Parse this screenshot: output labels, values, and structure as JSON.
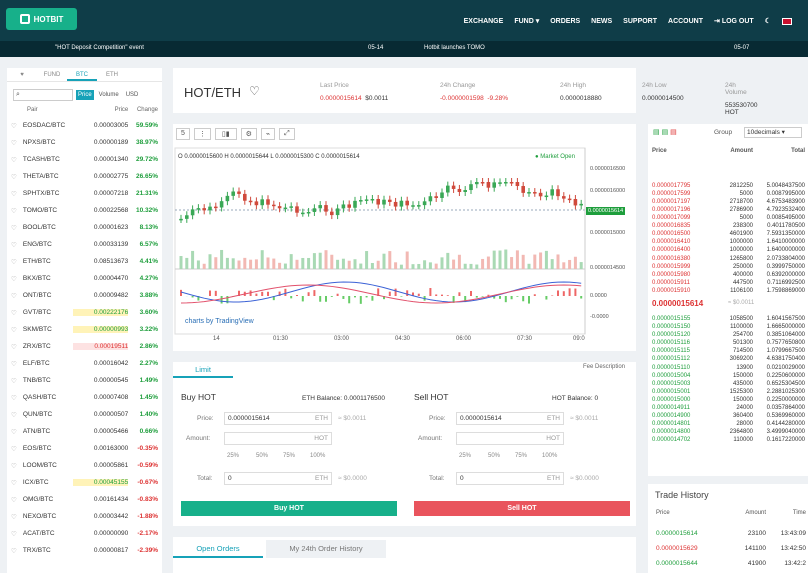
{
  "header": {
    "logo": "HOTBIT",
    "nav": [
      "EXCHANGE",
      "FUND ▾",
      "ORDERS",
      "NEWS",
      "SUPPORT",
      "ACCOUNT",
      "⇥ LOG OUT"
    ]
  },
  "ticker": {
    "left": "\"HOT Deposit Competition\" event",
    "date1": "05-14",
    "middle": "Hotbit launches TOMO",
    "date2": "05-07"
  },
  "market": {
    "tabs": [
      "♥",
      "FUND",
      "BTC",
      "ETH"
    ],
    "sort_buttons": [
      "Price",
      "Volume",
      "USD"
    ],
    "headers": [
      "Pair",
      "Price",
      "Change"
    ],
    "rows": [
      [
        "EOSDAC/BTC",
        "0.00003005",
        "59.59%",
        "g"
      ],
      [
        "NPXS/BTC",
        "0.00000189",
        "38.97%",
        "g"
      ],
      [
        "TCASH/BTC",
        "0.00001340",
        "29.72%",
        "g"
      ],
      [
        "THETA/BTC",
        "0.00002775",
        "26.65%",
        "g"
      ],
      [
        "SPHTX/BTC",
        "0.00007218",
        "21.31%",
        "g"
      ],
      [
        "TOMO/BTC",
        "0.00022568",
        "10.32%",
        "g"
      ],
      [
        "BOOL/BTC",
        "0.00001623",
        "8.13%",
        "g"
      ],
      [
        "ENG/BTC",
        "0.00033139",
        "6.57%",
        "g"
      ],
      [
        "ETH/BTC",
        "0.08513673",
        "4.41%",
        "g"
      ],
      [
        "BKX/BTC",
        "0.00004470",
        "4.27%",
        "g"
      ],
      [
        "ONT/BTC",
        "0.00009482",
        "3.88%",
        "g"
      ],
      [
        "GVT/BTC",
        "0.00222176",
        "3.60%",
        "g"
      ],
      [
        "SKM/BTC",
        "0.00000993",
        "3.22%",
        "g"
      ],
      [
        "ZRX/BTC",
        "0.00019511",
        "2.86%",
        "g"
      ],
      [
        "ELF/BTC",
        "0.00016042",
        "2.27%",
        "g"
      ],
      [
        "TNB/BTC",
        "0.00000545",
        "1.49%",
        "g"
      ],
      [
        "QASH/BTC",
        "0.00007408",
        "1.45%",
        "g"
      ],
      [
        "QUN/BTC",
        "0.00000507",
        "1.40%",
        "g"
      ],
      [
        "ATN/BTC",
        "0.00005466",
        "0.66%",
        "g"
      ],
      [
        "EOS/BTC",
        "0.00163000",
        "-0.35%",
        "rd"
      ],
      [
        "LOOM/BTC",
        "0.00005861",
        "-0.59%",
        "rd"
      ],
      [
        "ICX/BTC",
        "0.00045155",
        "-0.67%",
        "rd"
      ],
      [
        "OMG/BTC",
        "0.00161434",
        "-0.83%",
        "rd"
      ],
      [
        "NEXO/BTC",
        "0.00003442",
        "-1.88%",
        "rd"
      ],
      [
        "ACAT/BTC",
        "0.00000090",
        "-2.17%",
        "rd"
      ],
      [
        "TRX/BTC",
        "0.00000817",
        "-2.39%",
        "rd"
      ]
    ]
  },
  "pair": {
    "name": "HOT/ETH",
    "last_label": "Last Price",
    "last": "0.0000015614",
    "last_usd": "$0.0011",
    "chg_label": "24h Change",
    "chg": "-0.0000001598",
    "chg_pct": "-9.28%",
    "high_label": "24h High",
    "high": "0.0000018880",
    "low_label": "24h Low",
    "low": "0.0000014500",
    "vol_label": "24h Volume",
    "vol": "553530700 HOT"
  },
  "chart": {
    "ohlc": "O 0.0000015600  H 0.0000015644  L 0.0000015300  C 0.0000015614",
    "market_open": "● Market Open",
    "interval": "5",
    "price_tag": "0.0000015614",
    "watermark": "charts by TradingView",
    "times": [
      "14",
      "01:30",
      "03:00",
      "04:30",
      "06:00",
      "07:30",
      "09:0"
    ]
  },
  "trade": {
    "tab": "Limit",
    "fee": "Fee Description",
    "buy_title": "Buy HOT",
    "buy_bal": "ETH Balance: 0.0001176500",
    "sell_title": "Sell HOT",
    "sell_bal": "HOT Balance: 0",
    "price_lbl": "Price:",
    "amount_lbl": "Amount:",
    "total_lbl": "Total:",
    "price_val": "0.0000015614",
    "total_val": "0",
    "usd": "≈ $0.0011",
    "usd0": "≈ $0.0000",
    "pcts": [
      "25%",
      "50%",
      "75%",
      "100%"
    ],
    "buy_btn": "Buy HOT",
    "sell_btn": "Sell HOT",
    "eth": "ETH",
    "hot": "HOT"
  },
  "orders": {
    "tabs": [
      "Open Orders",
      "My 24th Order History"
    ]
  },
  "orderbook": {
    "group_lbl": "Group",
    "decimals": "10decimals ▾",
    "headers": [
      "Price",
      "Amount",
      "Total"
    ],
    "asks": [
      [
        "0.0000017795",
        "2812250",
        "5.0048437500"
      ],
      [
        "0.0000017599",
        "5000",
        "0.0087995000"
      ],
      [
        "0.0000017197",
        "2718700",
        "4.6753483900"
      ],
      [
        "0.0000017196",
        "2786900",
        "4.7923532400"
      ],
      [
        "0.0000017099",
        "5000",
        "0.0085495000"
      ],
      [
        "0.0000016835",
        "238300",
        "0.4011780500"
      ],
      [
        "0.0000016500",
        "4601900",
        "7.5931350000"
      ],
      [
        "0.0000016410",
        "1000000",
        "1.6410000000"
      ],
      [
        "0.0000016400",
        "1000000",
        "1.6400000000"
      ],
      [
        "0.0000016380",
        "1265800",
        "2.0733804000"
      ],
      [
        "0.0000015999",
        "250000",
        "0.3999750000"
      ],
      [
        "0.0000015980",
        "400000",
        "0.6392000000"
      ],
      [
        "0.0000015911",
        "447500",
        "0.7116992500"
      ],
      [
        "0.0000015910",
        "1106100",
        "1.7598869000"
      ]
    ],
    "mid": "0.0000015614",
    "mid_usd": "≈ $0.0011",
    "bids": [
      [
        "0.0000015155",
        "1058500",
        "1.6041567500"
      ],
      [
        "0.0000015150",
        "1100000",
        "1.6665000000"
      ],
      [
        "0.0000015120",
        "254700",
        "0.3851064000"
      ],
      [
        "0.0000015116",
        "501300",
        "0.7577650800"
      ],
      [
        "0.0000015115",
        "714500",
        "1.0799667500"
      ],
      [
        "0.0000015112",
        "3069200",
        "4.6381750400"
      ],
      [
        "0.0000015110",
        "13900",
        "0.0210029000"
      ],
      [
        "0.0000015004",
        "150000",
        "0.2250600000"
      ],
      [
        "0.0000015003",
        "435000",
        "0.6525304500"
      ],
      [
        "0.0000015001",
        "1525300",
        "2.2881025300"
      ],
      [
        "0.0000015000",
        "150000",
        "0.2250000000"
      ],
      [
        "0.0000014911",
        "24000",
        "0.0357864000"
      ],
      [
        "0.0000014900",
        "360400",
        "0.5369960000"
      ],
      [
        "0.0000014801",
        "28000",
        "0.4144280000"
      ],
      [
        "0.0000014800",
        "2364800",
        "3.4999040000"
      ],
      [
        "0.0000014702",
        "110000",
        "0.1617220000"
      ]
    ]
  },
  "trades": {
    "title": "Trade History",
    "headers": [
      "Price",
      "Amount",
      "Time"
    ],
    "rows": [
      [
        "0.0000015614",
        "23100",
        "13:43:09",
        "g"
      ],
      [
        "0.0000015629",
        "141100",
        "13:42:50",
        "rd"
      ],
      [
        "0.0000015644",
        "41900",
        "13:42:2",
        "g"
      ]
    ]
  }
}
